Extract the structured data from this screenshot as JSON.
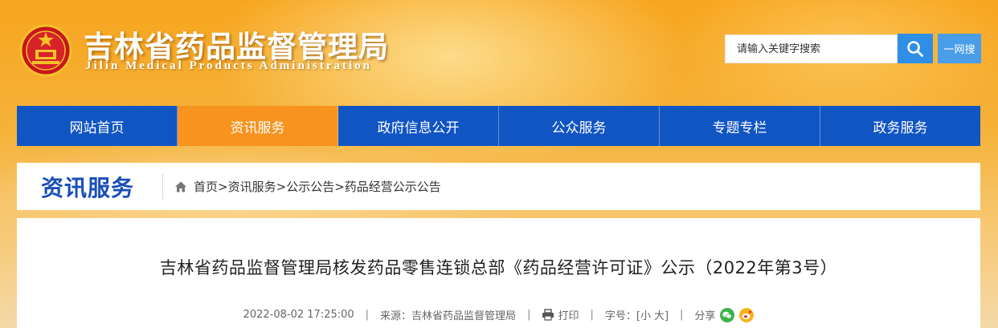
{
  "header": {
    "title_cn": "吉林省药品监督管理局",
    "title_en": "Jilin Medical Products Administration",
    "emblem_icon": "national-emblem-icon"
  },
  "search": {
    "placeholder": "请输入关键字搜索",
    "value": "",
    "button_icon": "search-icon",
    "site_search_label": "一网搜"
  },
  "nav": {
    "items": [
      {
        "label": "网站首页",
        "active": false
      },
      {
        "label": "资讯服务",
        "active": true
      },
      {
        "label": "政府信息公开",
        "active": false
      },
      {
        "label": "公众服务",
        "active": false
      },
      {
        "label": "专题专栏",
        "active": false
      },
      {
        "label": "政务服务",
        "active": false
      }
    ]
  },
  "section": {
    "title": "资讯服务",
    "breadcrumb": [
      "首页",
      "资讯服务",
      "公示公告",
      "药品经营公示公告"
    ],
    "breadcrumb_sep": ">"
  },
  "article": {
    "title": "吉林省药品监督管理局核发药品零售连锁总部《药品经营许可证》公示（2022年第3号）",
    "date": "2022-08-02 17:25:00",
    "source_label": "来源：",
    "source": "吉林省药品监督管理局",
    "print_label": "打印",
    "font_size_label": "字号：",
    "font_small": "[小",
    "font_large": "大]",
    "share_label": "分享",
    "meta_sep": "|"
  },
  "colors": {
    "nav_blue": "#1155c3",
    "nav_active_orange": "#f7931e",
    "section_title_blue": "#1a4fb8",
    "search_button_blue": "#2f8ee6"
  }
}
